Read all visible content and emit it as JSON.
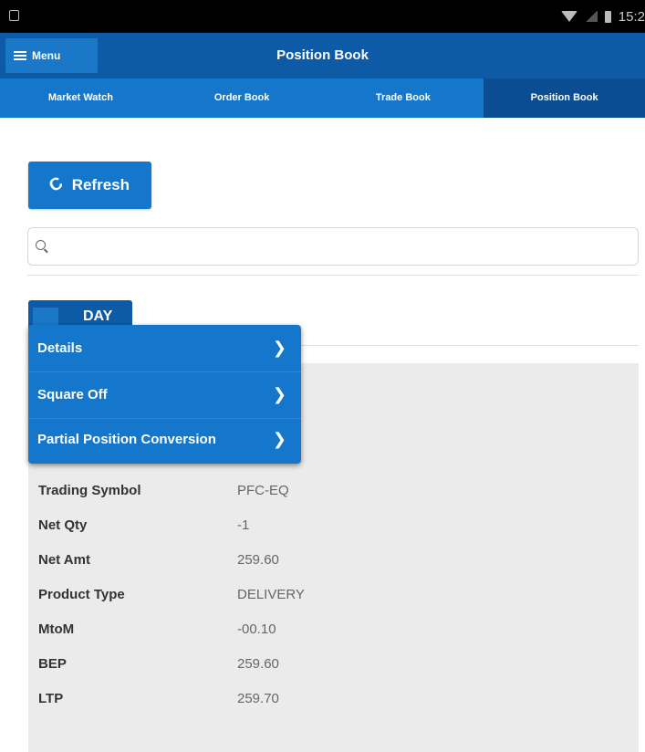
{
  "status_bar": {
    "time": "15:2",
    "icons": [
      "notification-icon",
      "wifi-icon",
      "signal-icon",
      "battery-icon"
    ]
  },
  "app_bar": {
    "menu_label": "Menu",
    "title": "Position Book"
  },
  "tabs": [
    {
      "label": "Market Watch",
      "active": false
    },
    {
      "label": "Order Book",
      "active": false
    },
    {
      "label": "Trade Book",
      "active": false
    },
    {
      "label": "Position Book",
      "active": true
    }
  ],
  "refresh_label": "Refresh",
  "search": {
    "placeholder": "",
    "value": ""
  },
  "day_tab_label": "DAY",
  "popup_menu": {
    "items": [
      {
        "label": "Details"
      },
      {
        "label": "Square Off"
      },
      {
        "label": "Partial Position Conversion"
      }
    ]
  },
  "details": [
    {
      "label": "Trading Symbol",
      "value": "PFC-EQ"
    },
    {
      "label": "Net Qty",
      "value": "-1"
    },
    {
      "label": "Net Amt",
      "value": "259.60"
    },
    {
      "label": "Product Type",
      "value": "DELIVERY"
    },
    {
      "label": "MtoM",
      "value": "-00.10"
    },
    {
      "label": "BEP",
      "value": "259.60"
    },
    {
      "label": "LTP",
      "value": "259.70"
    }
  ],
  "colors": {
    "app_bar": "#0d5aa7",
    "tab_bar": "#1577cc",
    "active_tab": "#0b4d93",
    "accent_button": "#1577cc",
    "panel_bg": "#ebebeb"
  }
}
